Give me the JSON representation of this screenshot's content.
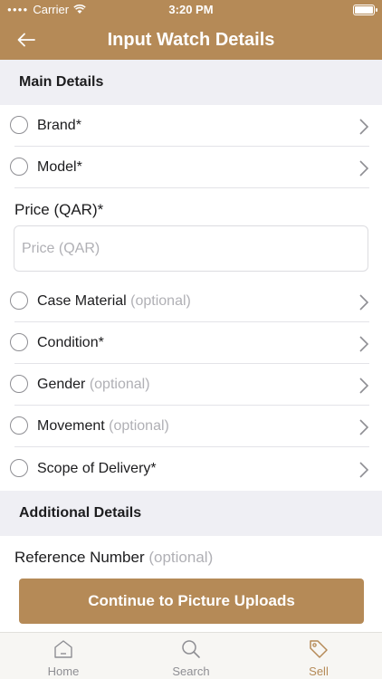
{
  "status_bar": {
    "carrier": "Carrier",
    "time": "3:20 PM"
  },
  "nav": {
    "title": "Input Watch Details"
  },
  "main_section": {
    "header": "Main Details",
    "brand": {
      "label": "Brand*"
    },
    "model": {
      "label": "Model*"
    },
    "price": {
      "label": "Price (QAR)*",
      "placeholder": "Price (QAR)"
    },
    "case_material": {
      "label": "Case Material",
      "note": "(optional)"
    },
    "condition": {
      "label": "Condition*"
    },
    "gender": {
      "label": "Gender",
      "note": "(optional)"
    },
    "movement": {
      "label": "Movement",
      "note": "(optional)"
    },
    "scope": {
      "label": "Scope of Delivery*"
    }
  },
  "additional_section": {
    "header": "Additional Details",
    "reference": {
      "label": "Reference Number",
      "note": "(optional)"
    }
  },
  "continue_label": "Continue to Picture Uploads",
  "tabs": [
    {
      "label": "Home",
      "icon": "home-icon",
      "active": false
    },
    {
      "label": "Search",
      "icon": "search-icon",
      "active": false
    },
    {
      "label": "Sell",
      "icon": "tag-icon",
      "active": true
    }
  ],
  "colors": {
    "brand": "#b58a57",
    "section_bg": "#efeff4",
    "muted": "#b0b0b5"
  }
}
